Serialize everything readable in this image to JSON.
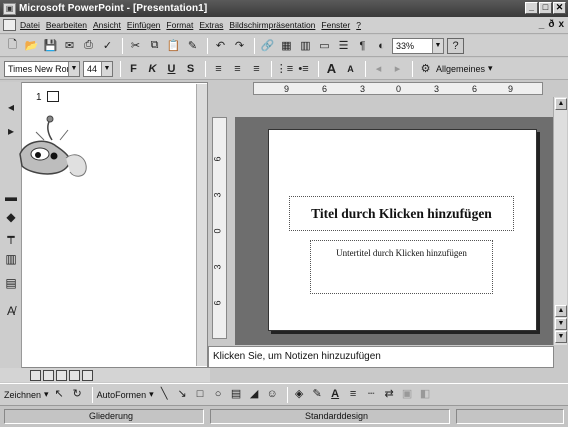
{
  "window": {
    "title": "Microsoft PowerPoint - [Presentation1]",
    "controls": [
      "_",
      "□",
      "✕"
    ]
  },
  "menubar": {
    "items": [
      "Datei",
      "Bearbeiten",
      "Ansicht",
      "Einfügen",
      "Format",
      "Extras",
      "Bildschirmpräsentation",
      "Fenster",
      "?"
    ],
    "doc_controls": [
      "_",
      "ð",
      "x"
    ]
  },
  "toolbar1": {
    "zoom": "33%",
    "help": "?"
  },
  "toolbar2": {
    "font": "Times New Roman",
    "font_size": "44",
    "bold": "F",
    "italic": "K",
    "underline": "U",
    "shadow": "S",
    "grow_font": "A",
    "shrink_font": "A",
    "tasks": "Allgemeines"
  },
  "outline": {
    "slide_number": "1"
  },
  "ruler": {
    "horizontal_ticks": [
      "9",
      "6",
      "3",
      "0",
      "3",
      "6",
      "9"
    ],
    "vertical_ticks": [
      "6",
      "3",
      "0",
      "3",
      "6"
    ]
  },
  "slide": {
    "title_placeholder": "Titel durch Klicken hinzufügen",
    "subtitle_placeholder": "Untertitel durch Klicken hinzufügen"
  },
  "notes": {
    "placeholder": "Klicken Sie, um Notizen hinzuzufügen"
  },
  "drawbar": {
    "draw_label": "Zeichnen",
    "autoshapes_label": "AutoFormen"
  },
  "statusbar": {
    "mode": "Gliederung",
    "design": "Standarddesign"
  }
}
